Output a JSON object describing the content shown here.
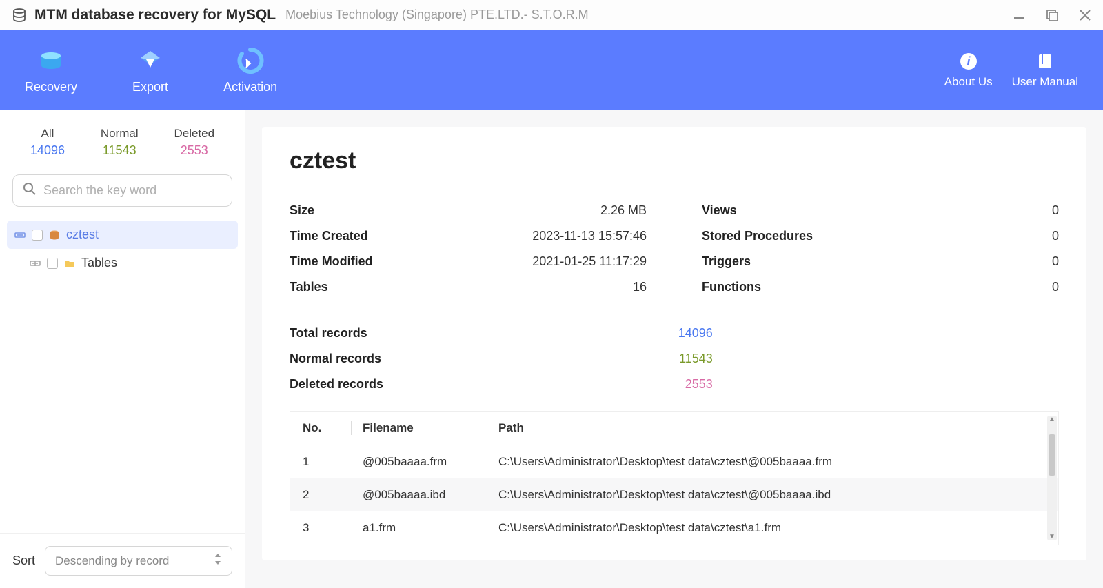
{
  "titlebar": {
    "app_title": "MTM database recovery for MySQL",
    "vendor": "Moebius Technology (Singapore) PTE.LTD.- S.T.O.R.M"
  },
  "toolbar": {
    "recovery": "Recovery",
    "export": "Export",
    "activation": "Activation",
    "about": "About Us",
    "manual": "User Manual"
  },
  "sidebar": {
    "stats": {
      "all_label": "All",
      "all_value": "14096",
      "normal_label": "Normal",
      "normal_value": "11543",
      "deleted_label": "Deleted",
      "deleted_value": "2553"
    },
    "search_placeholder": "Search the key word",
    "tree": {
      "db_name": "cztest",
      "tables_label": "Tables"
    },
    "sort_label": "Sort",
    "sort_value": "Descending by record"
  },
  "main": {
    "db_title": "cztest",
    "info_left": {
      "size_k": "Size",
      "size_v": "2.26 MB",
      "created_k": "Time Created",
      "created_v": "2023-11-13 15:57:46",
      "modified_k": "Time Modified",
      "modified_v": "2021-01-25 11:17:29",
      "tables_k": "Tables",
      "tables_v": "16"
    },
    "info_right": {
      "views_k": "Views",
      "views_v": "0",
      "sp_k": "Stored Procedures",
      "sp_v": "0",
      "trig_k": "Triggers",
      "trig_v": "0",
      "func_k": "Functions",
      "func_v": "0"
    },
    "records": {
      "total_k": "Total records",
      "total_v": "14096",
      "normal_k": "Normal records",
      "normal_v": "11543",
      "deleted_k": "Deleted records",
      "deleted_v": "2553"
    },
    "table": {
      "h_no": "No.",
      "h_fn": "Filename",
      "h_path": "Path",
      "rows": [
        {
          "no": "1",
          "fn": "@005baaaa.frm",
          "path": "C:\\Users\\Administrator\\Desktop\\test data\\cztest\\@005baaaa.frm"
        },
        {
          "no": "2",
          "fn": "@005baaaa.ibd",
          "path": "C:\\Users\\Administrator\\Desktop\\test data\\cztest\\@005baaaa.ibd"
        },
        {
          "no": "3",
          "fn": "a1.frm",
          "path": "C:\\Users\\Administrator\\Desktop\\test data\\cztest\\a1.frm"
        }
      ]
    }
  }
}
